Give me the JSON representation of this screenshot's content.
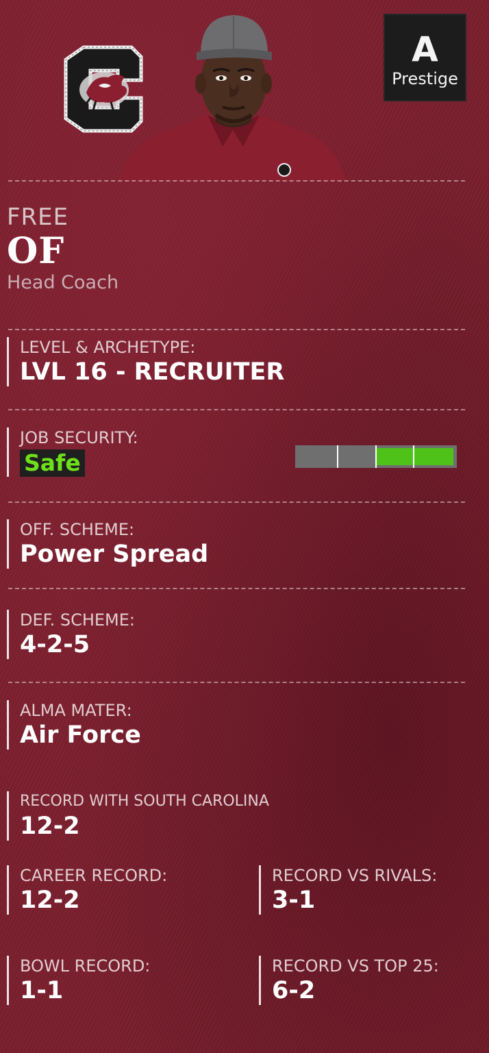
{
  "coach": {
    "first_name": "FREE",
    "last_name": "OF",
    "role": "Head Coach"
  },
  "team_logo": {
    "icon": "south-carolina-gamecocks-logo-icon",
    "color": "#7a1f2e"
  },
  "prestige": {
    "grade": "A",
    "label": "Prestige"
  },
  "level_archetype": {
    "label": "LEVEL & ARCHETYPE:",
    "value": "LVL 16 - RECRUITER"
  },
  "job_security": {
    "label": "JOB SECURITY:",
    "value": "Safe",
    "level_fraction": 0.5,
    "segments": 4,
    "fill_color": "#4fc21a",
    "text_color": "#6ee11b"
  },
  "off_scheme": {
    "label": "OFF. SCHEME:",
    "value": "Power Spread"
  },
  "def_scheme": {
    "label": "DEF. SCHEME:",
    "value": "4-2-5"
  },
  "alma_mater": {
    "label": "ALMA MATER:",
    "value": "Air Force"
  },
  "record_with_team": {
    "label": "RECORD WITH SOUTH CAROLINA",
    "value": "12-2"
  },
  "career_record": {
    "label": "CAREER RECORD:",
    "value": "12-2"
  },
  "record_vs_rivals": {
    "label": "RECORD VS RIVALS:",
    "value": "3-1"
  },
  "bowl_record": {
    "label": "BOWL RECORD:",
    "value": "1-1"
  },
  "record_vs_top25": {
    "label": "RECORD VS TOP 25:",
    "value": "6-2"
  }
}
